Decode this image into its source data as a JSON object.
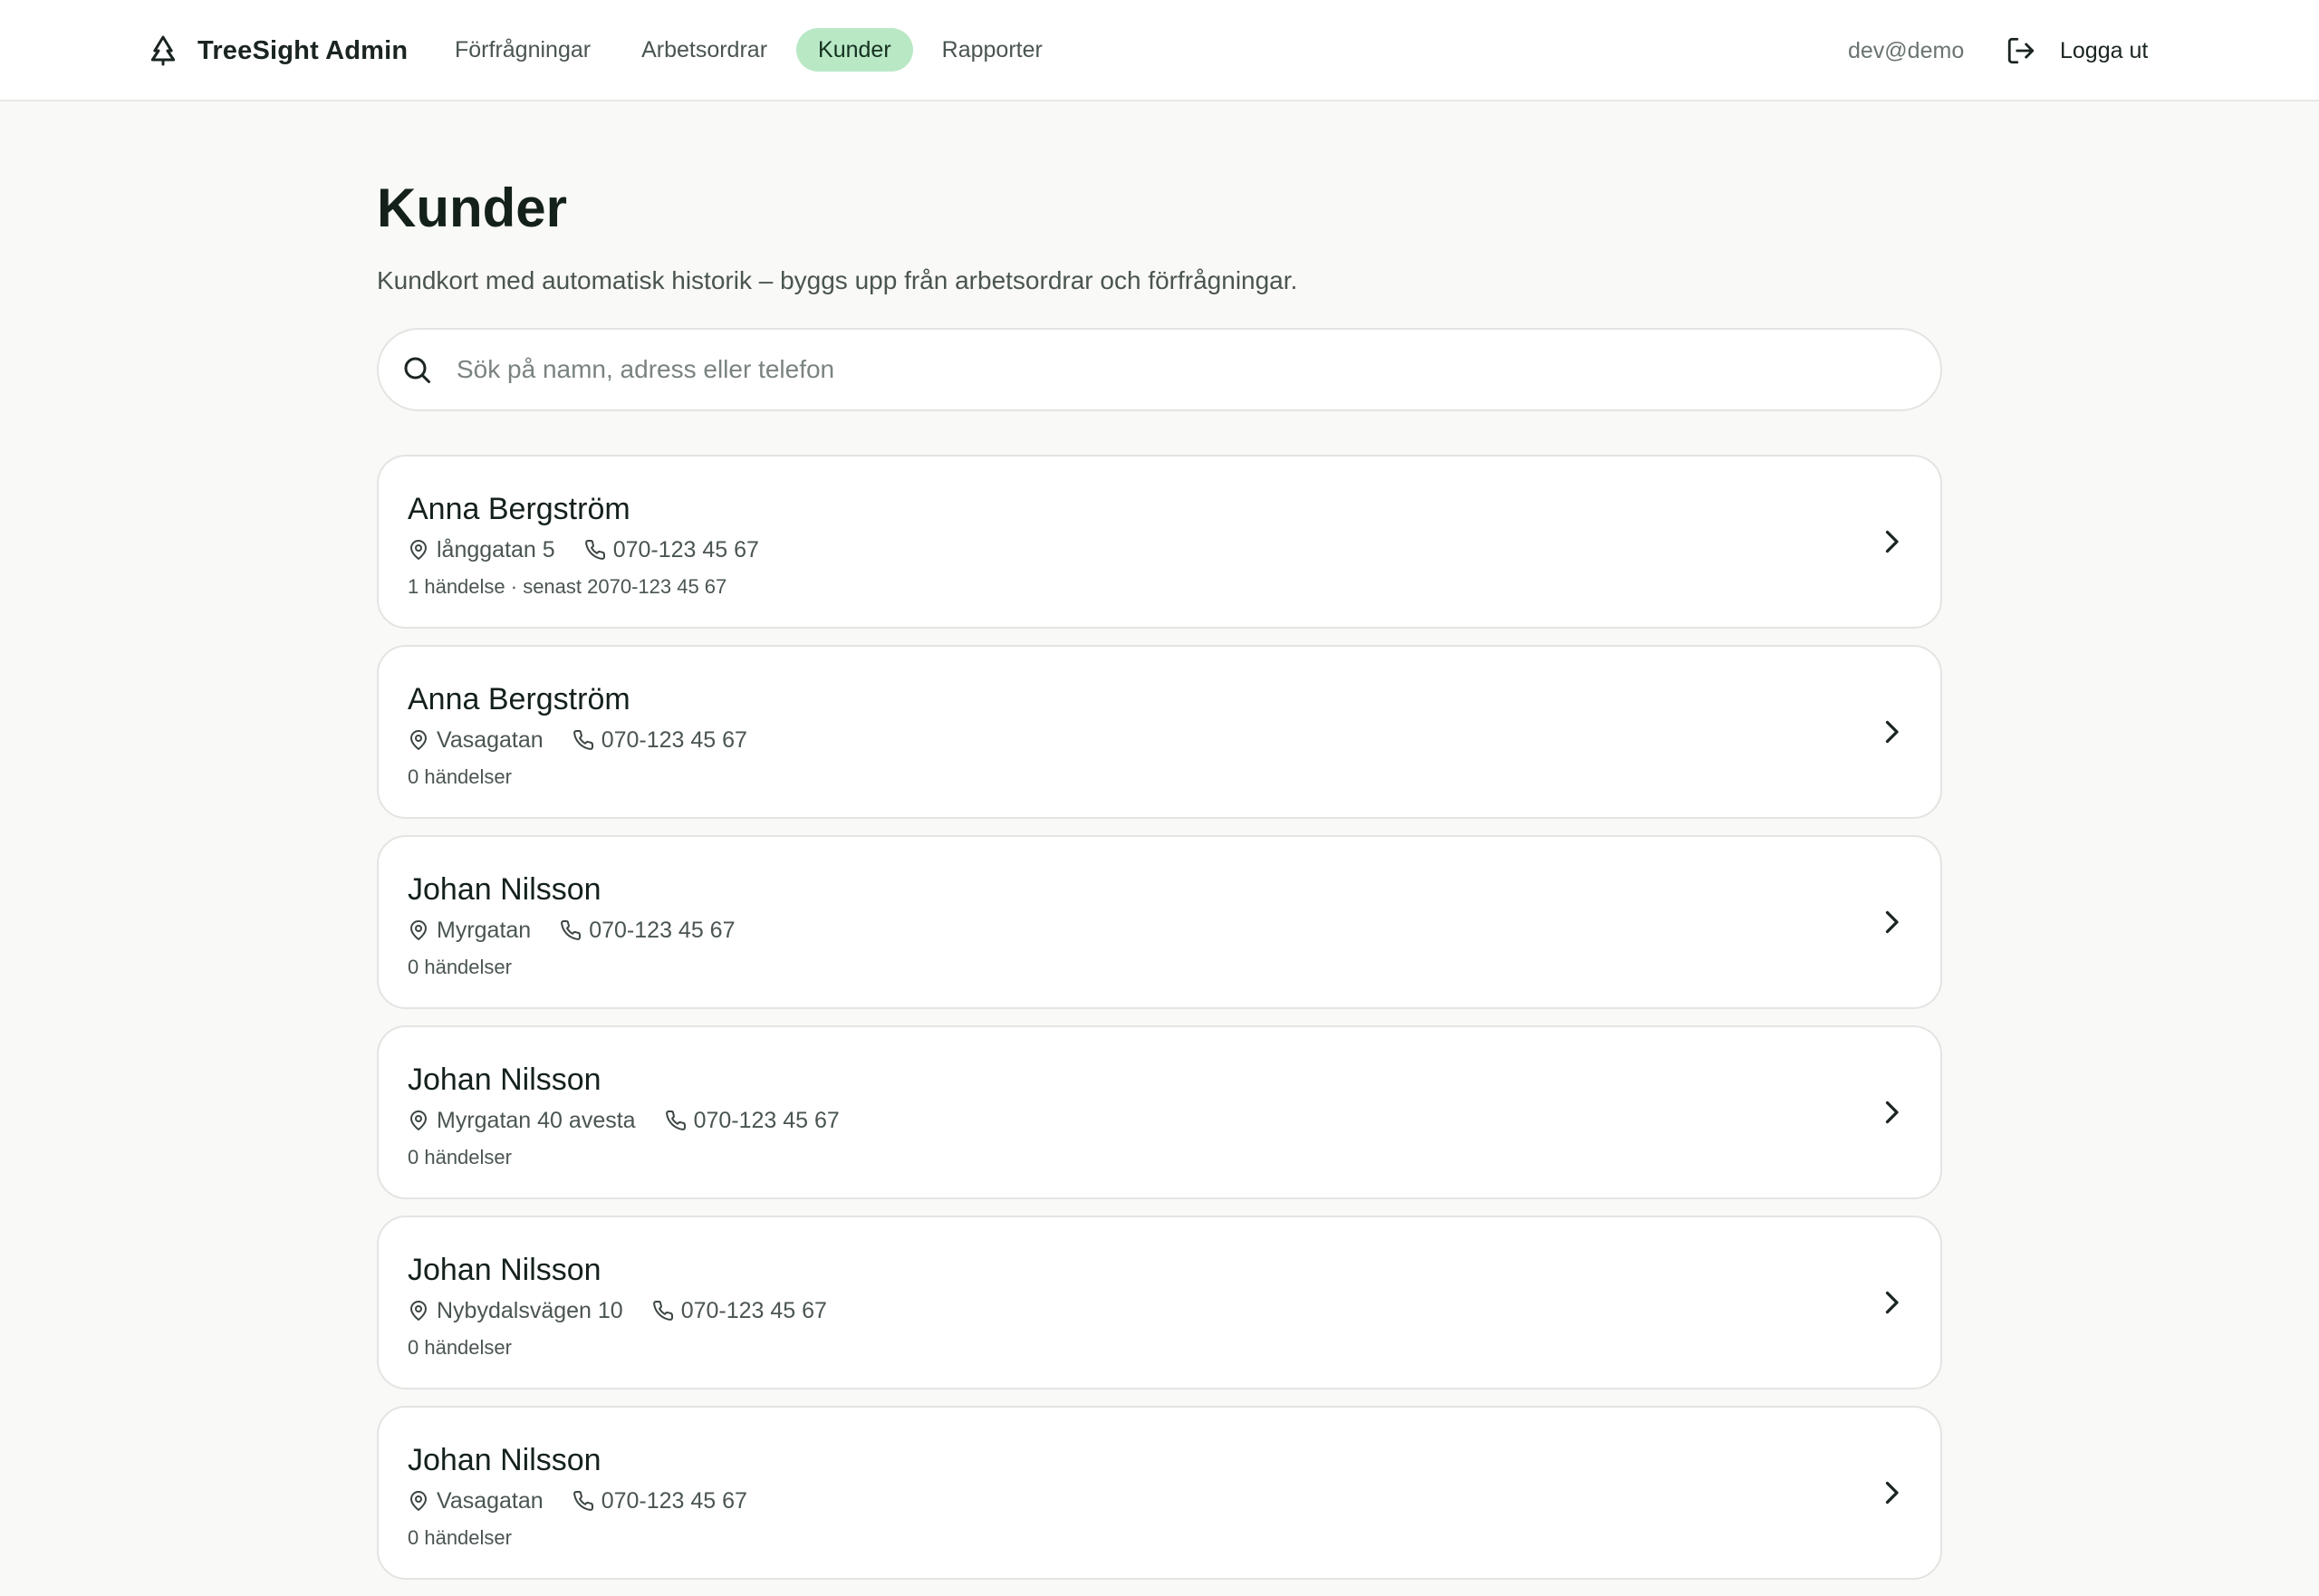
{
  "app": {
    "brand": "TreeSight Admin"
  },
  "nav": {
    "items": [
      {
        "label": "Förfrågningar",
        "active": false
      },
      {
        "label": "Arbetsordrar",
        "active": false
      },
      {
        "label": "Kunder",
        "active": true
      },
      {
        "label": "Rapporter",
        "active": false
      }
    ]
  },
  "user": {
    "email": "dev@demo",
    "logout_label": "Logga ut"
  },
  "page": {
    "title": "Kunder",
    "subtitle": "Kundkort med automatisk historik – byggs upp från arbetsordrar och förfrågningar."
  },
  "search": {
    "placeholder": "Sök på namn, adress eller telefon",
    "value": ""
  },
  "customers": [
    {
      "name": "Anna Bergström",
      "address": "långgatan 5",
      "phone": "070-123 45 67",
      "events": "1 händelse · senast 2070-123 45 67"
    },
    {
      "name": "Anna Bergström",
      "address": "Vasagatan",
      "phone": "070-123 45 67",
      "events": "0 händelser"
    },
    {
      "name": "Johan Nilsson",
      "address": "Myrgatan",
      "phone": "070-123 45 67",
      "events": "0 händelser"
    },
    {
      "name": "Johan Nilsson",
      "address": "Myrgatan 40 avesta",
      "phone": "070-123 45 67",
      "events": "0 händelser"
    },
    {
      "name": "Johan Nilsson",
      "address": "Nybydalsvägen 10",
      "phone": "070-123 45 67",
      "events": "0 händelser"
    },
    {
      "name": "Johan Nilsson",
      "address": "Vasagatan",
      "phone": "070-123 45 67",
      "events": "0 händelser"
    }
  ],
  "icons": {
    "brand": "tree-icon",
    "logout": "logout-icon",
    "search": "search-icon",
    "address": "map-pin-icon",
    "phone": "phone-icon",
    "row_action": "chevron-right-icon"
  },
  "colors": {
    "active_nav_bg": "#b9e8c5",
    "page_bg": "#f9f9f7",
    "card_bg": "#ffffff",
    "border": "#e2e5e1"
  }
}
